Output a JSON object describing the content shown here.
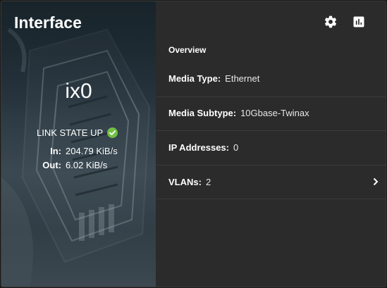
{
  "card": {
    "title": "Interface",
    "interface_name": "ix0",
    "link_state": "LINK STATE UP",
    "traffic": [
      {
        "label": "In:",
        "value": "204.79 KiB/s"
      },
      {
        "label": "Out:",
        "value": "6.02 KiB/s"
      }
    ]
  },
  "toolbar": {
    "settings_icon": "gear-icon",
    "reports_icon": "bar-chart-icon"
  },
  "details": {
    "section_title": "Overview",
    "media_type": {
      "label": "Media Type:",
      "value": "Ethernet"
    },
    "media_subtype": {
      "label": "Media Subtype:",
      "value": "10Gbase-Twinax"
    },
    "ip_addresses": {
      "label": "IP Addresses:",
      "value": "0"
    },
    "vlans": {
      "label": "VLANs:",
      "value": "2"
    }
  },
  "colors": {
    "background": "#2b2b2b",
    "status_ok": "#71bf44",
    "text": "#ffffff"
  }
}
